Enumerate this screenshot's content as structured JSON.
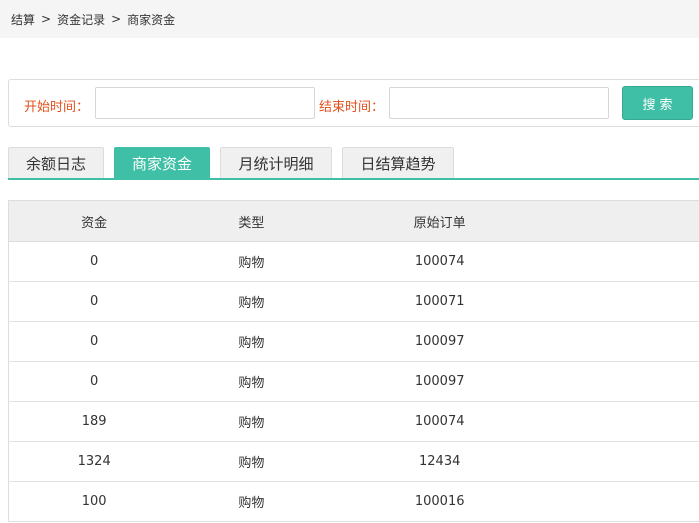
{
  "breadcrumb": {
    "items": [
      "结算",
      "资金记录",
      "商家资金"
    ],
    "separator": ">"
  },
  "search": {
    "start_label": "开始时间：",
    "start_value": "",
    "end_label": "结束时间：",
    "end_value": "",
    "button_label": "搜索"
  },
  "tabs": [
    {
      "label": "余额日志",
      "active": false
    },
    {
      "label": "商家资金",
      "active": true
    },
    {
      "label": "月统计明细",
      "active": false
    },
    {
      "label": "日结算趋势",
      "active": false
    }
  ],
  "table": {
    "headers": [
      "资金",
      "类型",
      "原始订单"
    ],
    "rows": [
      [
        "0",
        "购物",
        "100074"
      ],
      [
        "0",
        "购物",
        "100071"
      ],
      [
        "0",
        "购物",
        "100097"
      ],
      [
        "0",
        "购物",
        "100097"
      ],
      [
        "189",
        "购物",
        "100074"
      ],
      [
        "1324",
        "购物",
        "12434"
      ],
      [
        "100",
        "购物",
        "100016"
      ]
    ]
  },
  "colors": {
    "accent": "#3fbfa5",
    "label": "#e2511c",
    "header_bg": "#efefef"
  }
}
